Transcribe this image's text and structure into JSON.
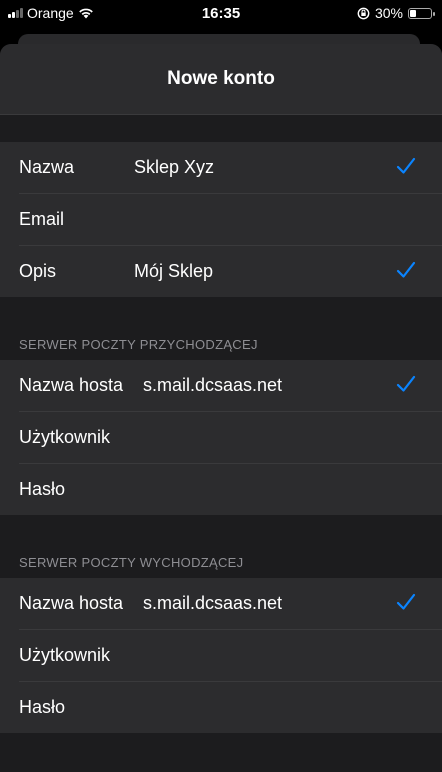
{
  "status_bar": {
    "carrier": "Orange",
    "time": "16:35",
    "battery": "30%",
    "battery_level": 0.3
  },
  "nav": {
    "title": "Nowe konto"
  },
  "account": {
    "rows": [
      {
        "label": "Nazwa",
        "value": "Sklep Xyz",
        "checked": true
      },
      {
        "label": "Email",
        "value": "",
        "checked": false
      },
      {
        "label": "Opis",
        "value": "Mój Sklep",
        "checked": true
      }
    ]
  },
  "incoming": {
    "header": "SERWER POCZTY PRZYCHODZĄCEJ",
    "rows": [
      {
        "label": "Nazwa hosta",
        "value": "s.mail.dcsaas.net",
        "checked": true
      },
      {
        "label": "Użytkownik",
        "value": "",
        "checked": false
      },
      {
        "label": "Hasło",
        "value": "",
        "checked": false
      }
    ]
  },
  "outgoing": {
    "header": "SERWER POCZTY WYCHODZĄCEJ",
    "rows": [
      {
        "label": "Nazwa hosta",
        "value": "s.mail.dcsaas.net",
        "checked": true
      },
      {
        "label": "Użytkownik",
        "value": "",
        "checked": false
      },
      {
        "label": "Hasło",
        "value": "",
        "checked": false
      }
    ]
  },
  "colors": {
    "accent": "#0a84ff",
    "background": "#1c1c1e",
    "cell": "#2c2c2e"
  }
}
